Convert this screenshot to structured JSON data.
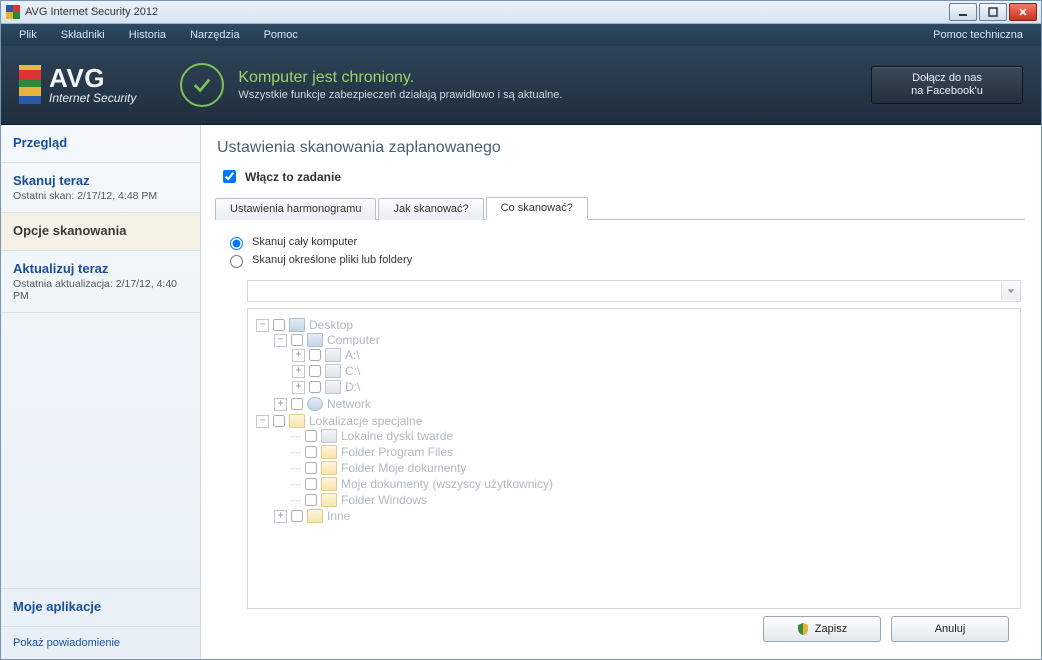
{
  "window": {
    "title": "AVG Internet Security 2012"
  },
  "menubar": {
    "items": [
      "Plik",
      "Składniki",
      "Historia",
      "Narzędzia",
      "Pomoc"
    ],
    "right": "Pomoc techniczna"
  },
  "brand": {
    "name": "AVG",
    "product": "Internet Security"
  },
  "status": {
    "headline": "Komputer jest chroniony.",
    "sub": "Wszystkie funkcje zabezpieczeń działają prawidłowo i są aktualne."
  },
  "facebook": {
    "line1": "Dołącz do nas",
    "line2": "na Facebook'u"
  },
  "sidebar": {
    "overview": {
      "title": "Przegląd"
    },
    "scan_now": {
      "title": "Skanuj teraz",
      "sub": "Ostatni skan: 2/17/12, 4:48 PM"
    },
    "scan_options": {
      "title": "Opcje skanowania"
    },
    "update_now": {
      "title": "Aktualizuj teraz",
      "sub": "Ostatnia aktualizacja: 2/17/12, 4:40 PM"
    },
    "my_apps": {
      "title": "Moje aplikacje"
    },
    "show_notification": "Pokaż powiadomienie"
  },
  "page": {
    "title": "Ustawienia skanowania zaplanowanego",
    "enable_label": "Włącz to zadanie",
    "enable_checked": true
  },
  "tabs": {
    "schedule": "Ustawienia harmonogramu",
    "how": "Jak skanować?",
    "what": "Co skanować?",
    "active": "what"
  },
  "radios": {
    "whole": "Skanuj cały komputer",
    "selected": "Skanuj określone pliki lub foldery",
    "value": "whole"
  },
  "combo": {
    "value": ""
  },
  "tree": {
    "desktop": "Desktop",
    "computer": "Computer",
    "drive_a": "A:\\",
    "drive_c": "C:\\",
    "drive_d": "D:\\",
    "network": "Network",
    "special": "Lokalizacje specjalne",
    "local_hdd": "Lokalne dyski twarde",
    "program_files": "Folder Program Files",
    "my_docs": "Folder Moje dokumenty",
    "my_docs_all": "Moje dokumenty (wszyscy użytkownicy)",
    "windows": "Folder Windows",
    "other": "Inne"
  },
  "buttons": {
    "save": "Zapisz",
    "cancel": "Anuluj"
  }
}
